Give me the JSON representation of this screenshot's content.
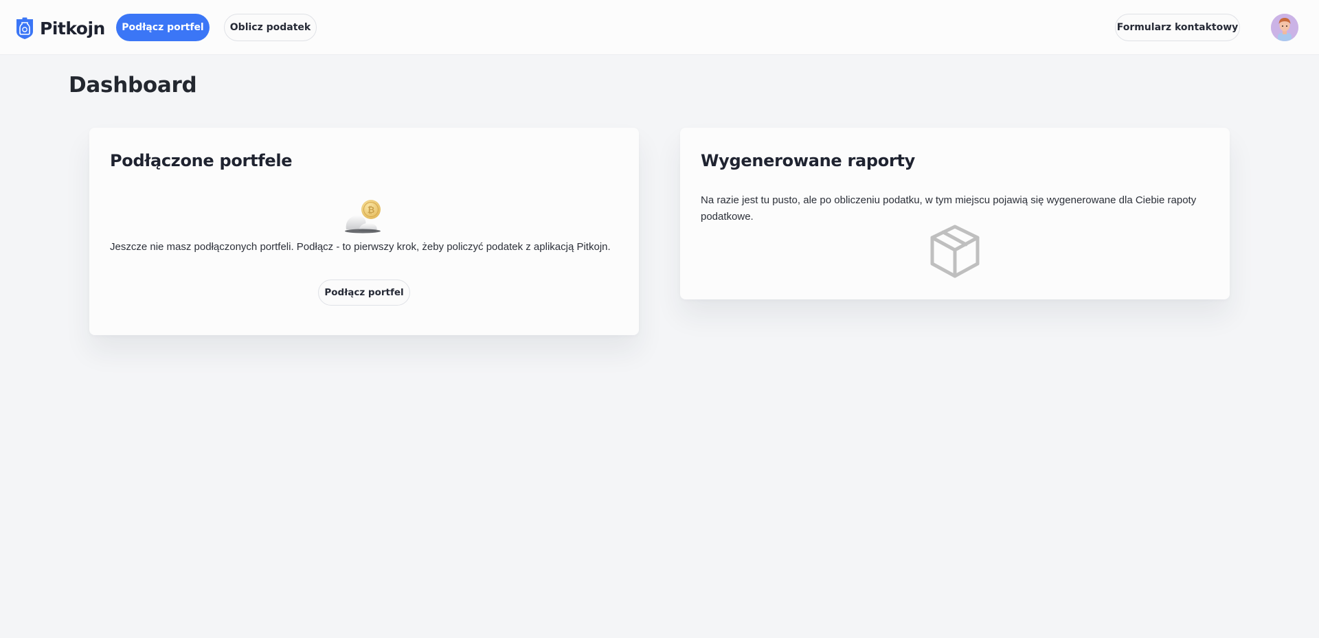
{
  "app": {
    "brand": "Pitkojn"
  },
  "navbar": {
    "connect_wallet_label": "Podłącz portfel",
    "calculate_tax_label": "Oblicz podatek",
    "contact_form_label": "Formularz kontaktowy",
    "avatar_icon": "user-avatar"
  },
  "page": {
    "title": "Dashboard"
  },
  "wallets_card": {
    "title": "Podłączone portfele",
    "empty_text": "Jeszcze nie masz podłączonych portfeli. Podłącz - to pierwszy krok, żeby policzyć podatek z aplikacją Pitkojn.",
    "illustration_icon": "coin-rocks-illustration",
    "connect_button_label": "Podłącz portfel"
  },
  "reports_card": {
    "title": "Wygenerowane raporty",
    "empty_text": "Na razie jest tu pusto, ale po obliczeniu podatku, w tym miejscu pojawią się wygenerowane dla Ciebie rapoty podatkowe.",
    "empty_icon": "empty-box-icon"
  },
  "colors": {
    "accent": "#3b76f6",
    "background": "#f4f5f7",
    "card": "#fcfcfc",
    "text": "#1f2330"
  }
}
